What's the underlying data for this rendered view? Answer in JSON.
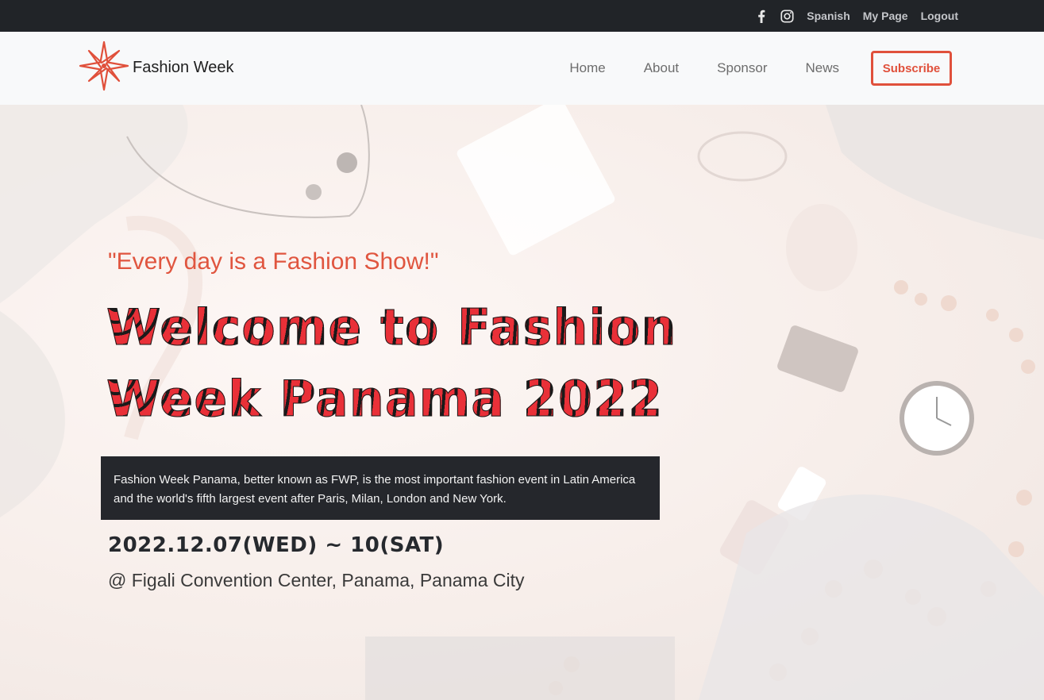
{
  "topbar": {
    "social_icons": [
      "facebook-icon",
      "instagram-icon"
    ],
    "links": [
      "Spanish",
      "My Page",
      "Logout"
    ]
  },
  "nav": {
    "brand": "Fashion Week",
    "logo_icon": "compass-star-icon",
    "items": [
      "Home",
      "About",
      "Sponsor",
      "News"
    ],
    "cta": "Subscribe"
  },
  "hero": {
    "quote": "\"Every day is a Fashion Show!\"",
    "title_line1": "Welcome to Fashion",
    "title_line2": "Week Panama 2022",
    "description": "Fashion Week Panama, better known as FWP, is the most important fashion event in Latin America and the world's fifth largest event after Paris, Milan, London and New York.",
    "dates": "2022.12.07(WED) ~ 10(SAT)",
    "venue": "@ Figali Convention Center, Panama, Panama City"
  },
  "colors": {
    "accent": "#e0503b",
    "topbar_bg": "#212428",
    "nav_bg": "#f8f9fa",
    "desc_bg": "#25272c"
  }
}
